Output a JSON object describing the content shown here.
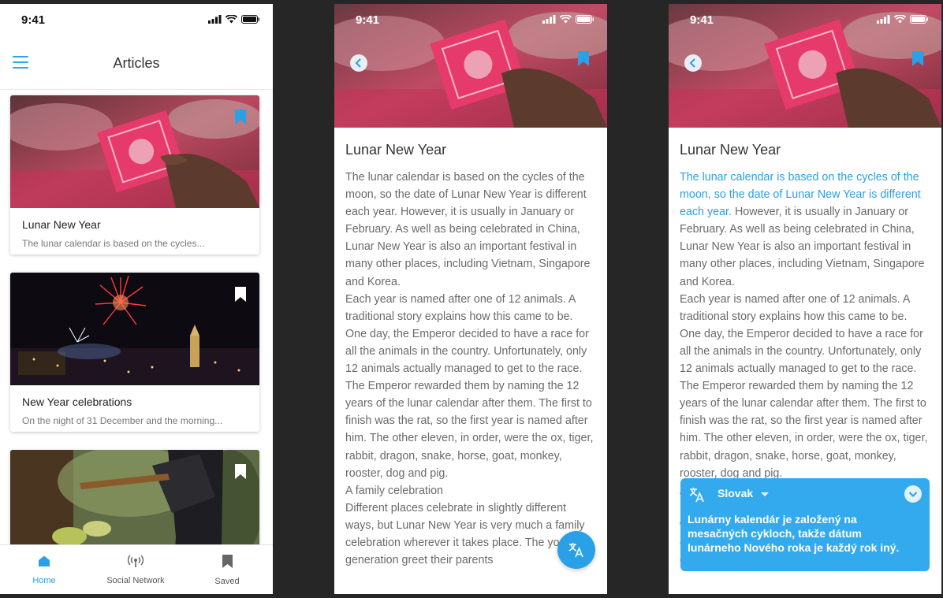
{
  "status_bar": {
    "time": "9:41"
  },
  "list_screen": {
    "title": "Articles",
    "cards": [
      {
        "title": "Lunar New Year",
        "excerpt": "The lunar calendar is based on the cycles...",
        "bookmarked": true
      },
      {
        "title": "New Year celebrations",
        "excerpt": "On the night of 31 December and the morning...",
        "bookmarked": false
      },
      {
        "title": "",
        "excerpt": "",
        "bookmarked": false
      }
    ],
    "tabs": [
      {
        "label": "Home",
        "icon": "home-icon",
        "active": true
      },
      {
        "label": "Social Network",
        "icon": "social-network-icon",
        "active": false
      },
      {
        "label": "Saved",
        "icon": "bookmark-icon",
        "active": false
      }
    ]
  },
  "article": {
    "title": "Lunar New Year",
    "highlighted": "The lunar calendar is based on the cycles of the moon, so the date of Lunar New Year is different each year.",
    "rest": " However, it is usually in January or February. As well as being celebrated in China, Lunar New Year is also an important festival in many other places, including Vietnam, Singapore and Korea.\nEach year is named after one of 12 animals. A traditional story explains how this came to be. One day, the Emperor decided to have a race for all the animals in the country. Unfortunately, only 12 animals actually managed to get to the race. The Emperor rewarded them by naming the 12 years of the lunar calendar after them. The first to finish was the rat, so the first year is named after him. The other eleven, in order, were the ox, tiger, rabbit, dragon, snake, horse, goat, monkey, rooster, dog and pig.\nA family celebration\nDifferent places celebrate in slightly different ways, but Lunar New Year is very much a family celebration wherever it takes place. The younger generation greet their parents",
    "bookmarked": true
  },
  "translation": {
    "language": "Slovak",
    "text": "Lunárny kalendár je založený na mesačných cykloch, takže dátum lunárneho Nového roka je každý rok iný."
  },
  "colors": {
    "accent": "#2aa0e6",
    "background": "#262626"
  }
}
